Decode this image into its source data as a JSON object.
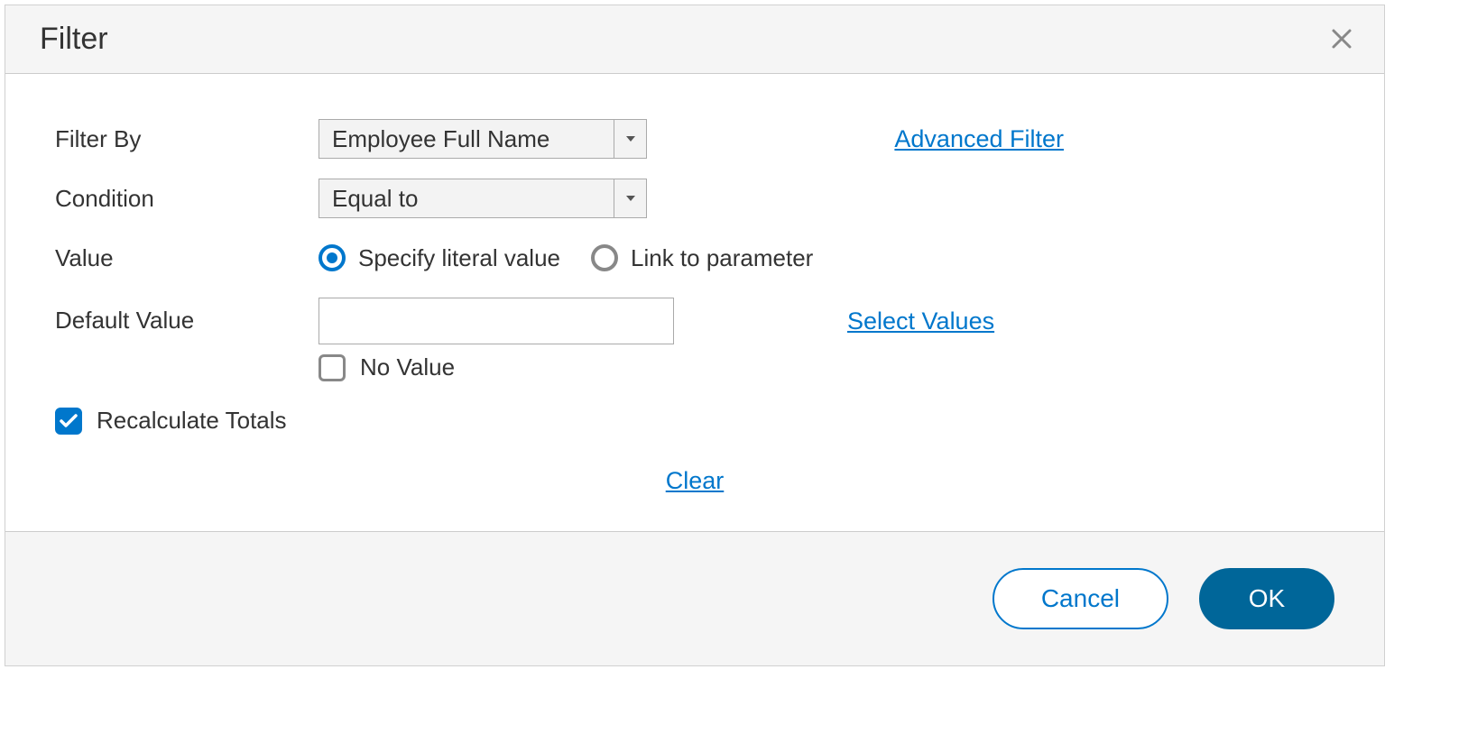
{
  "dialog": {
    "title": "Filter",
    "labels": {
      "filter_by": "Filter By",
      "condition": "Condition",
      "value": "Value",
      "default_value": "Default Value"
    },
    "filter_by_select": "Employee Full Name",
    "condition_select": "Equal to",
    "value_options": {
      "specify_literal": "Specify literal value",
      "link_parameter": "Link to parameter"
    },
    "default_value_input": "",
    "no_value_label": "No Value",
    "recalculate_label": "Recalculate Totals",
    "links": {
      "advanced": "Advanced Filter",
      "select_values": "Select Values",
      "clear": "Clear"
    },
    "buttons": {
      "cancel": "Cancel",
      "ok": "OK"
    }
  }
}
